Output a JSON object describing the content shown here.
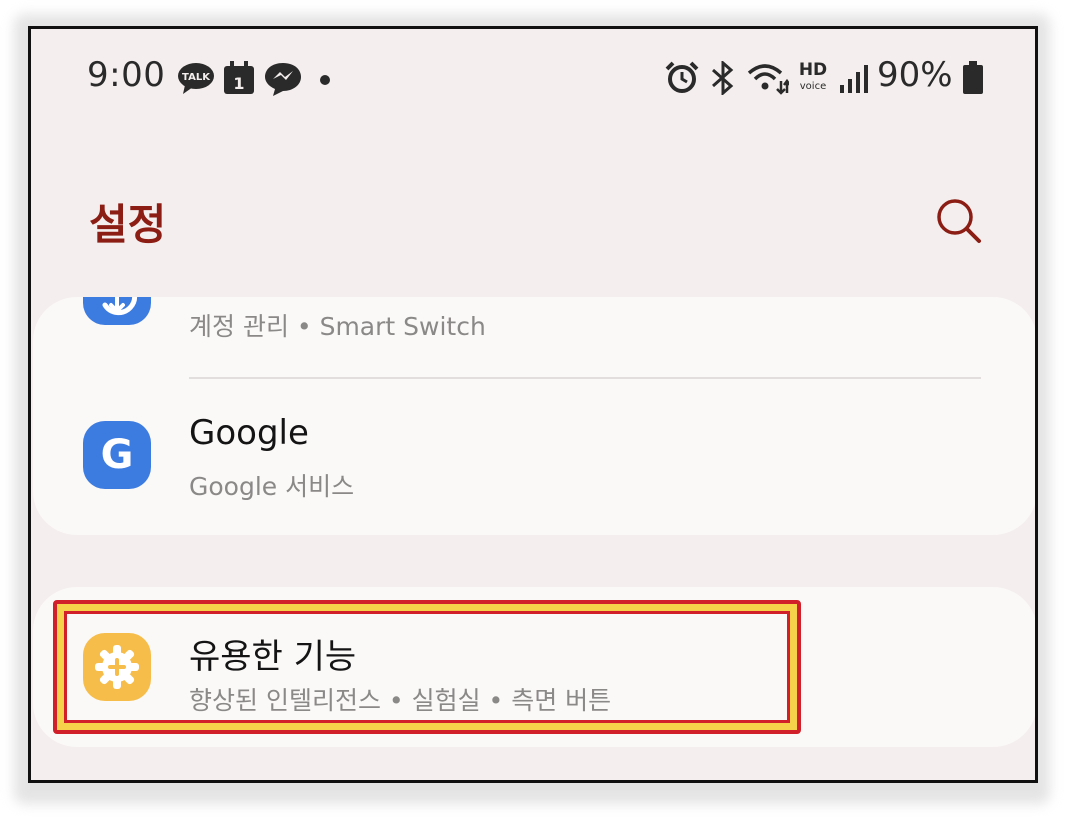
{
  "status_bar": {
    "time": "9:00",
    "kakao_badge": "TALK",
    "calendar_day": "1",
    "network_label": "HD",
    "network_sublabel": "voice",
    "battery": "90%"
  },
  "header": {
    "title": "설정"
  },
  "card1": {
    "partial_item": {
      "subtitle": "계정 관리 • Smart Switch"
    },
    "google_item": {
      "title": "Google",
      "subtitle": "Google 서비스",
      "icon_letter": "G"
    }
  },
  "card2": {
    "utilities_item": {
      "title": "유용한 기능",
      "subtitle": "향상된 인텔리전스 • 실험실 • 측면 버튼"
    }
  },
  "colors": {
    "title_accent": "#8b1d14",
    "google_icon_bg": "#3c7be0",
    "utilities_icon_bg": "#f6bd4a",
    "highlight_outer": "#d2202a",
    "highlight_inner": "#f6d24a"
  }
}
